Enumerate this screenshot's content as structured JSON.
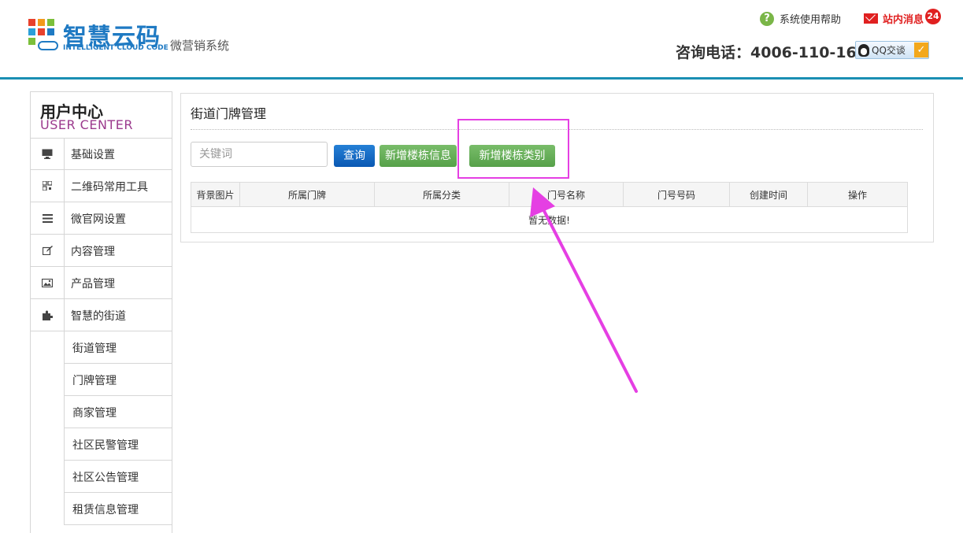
{
  "brand": {
    "title": "智慧云码",
    "subtitle": "INTELLIGENT CLOUD CODE",
    "system_name": "微营销系统"
  },
  "header": {
    "help_label": "系统使用帮助",
    "message_label": "站内消息",
    "message_count": "24",
    "phone": "咨询电话：4006-110-166",
    "qq_label": "QQ交谈"
  },
  "sidebar": {
    "title_cn": "用户中心",
    "title_en": "USER CENTER",
    "items": [
      {
        "label": "基础设置",
        "icon": "monitor-icon"
      },
      {
        "label": "二维码常用工具",
        "icon": "qrcode-icon"
      },
      {
        "label": "微官网设置",
        "icon": "list-icon"
      },
      {
        "label": "内容管理",
        "icon": "edit-icon"
      },
      {
        "label": "产品管理",
        "icon": "image-icon"
      },
      {
        "label": "智慧的街道",
        "icon": "puzzle-icon"
      }
    ],
    "sub_items": [
      {
        "label": "街道管理"
      },
      {
        "label": "门牌管理"
      },
      {
        "label": "商家管理"
      },
      {
        "label": "社区民警管理"
      },
      {
        "label": "社区公告管理"
      },
      {
        "label": "租赁信息管理"
      }
    ]
  },
  "main": {
    "title": "街道门牌管理",
    "search": {
      "placeholder": "关键词",
      "value": ""
    },
    "buttons": {
      "query": "查询",
      "add_building_info": "新增楼栋信息",
      "add_building_category": "新增楼栋类别"
    },
    "table": {
      "columns": [
        "背景图片",
        "所属门牌",
        "所属分类",
        "门号名称",
        "门号号码",
        "创建时间",
        "操作"
      ],
      "empty_text": "暂无数据!"
    }
  },
  "colors": {
    "brand_blue": "#1f7ac3",
    "header_rule": "#1a8fb3",
    "query_button": "#0a58b3",
    "green_button": "#5aa54c",
    "annotation_magenta": "#e53fe3",
    "alert_red": "#e02020"
  }
}
